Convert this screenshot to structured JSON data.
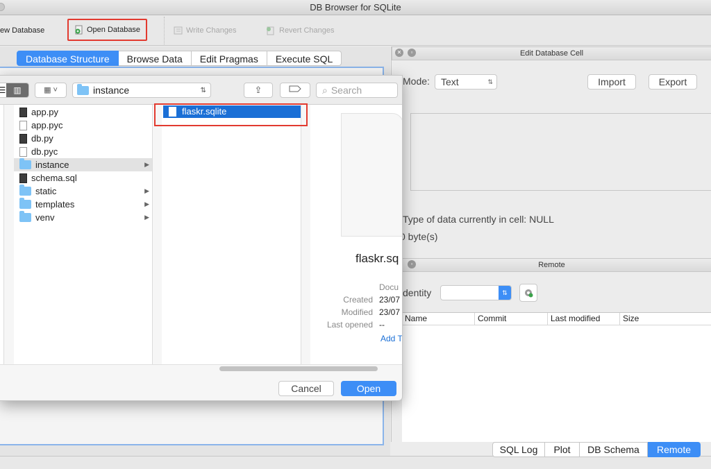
{
  "window": {
    "title": "DB Browser for SQLite"
  },
  "toolbar": {
    "new_database": "ew Database",
    "open_database": "Open Database",
    "write_changes": "Write Changes",
    "revert_changes": "Revert Changes"
  },
  "main_tabs": [
    "Database Structure",
    "Browse Data",
    "Edit Pragmas",
    "Execute SQL"
  ],
  "edit_cell": {
    "title": "Edit Database Cell",
    "mode_label": "Mode:",
    "mode_value": "Text",
    "import_label": "Import",
    "export_label": "Export",
    "type_info": "Type of data currently in cell: NULL",
    "size_info": "0 byte(s)"
  },
  "remote": {
    "title": "Remote",
    "identity_label": "dentity",
    "columns": [
      "Name",
      "Commit",
      "Last modified",
      "Size"
    ]
  },
  "bottom_tabs": [
    "SQL Log",
    "Plot",
    "DB Schema",
    "Remote"
  ],
  "dialog": {
    "location": "instance",
    "search_placeholder": "Search",
    "files": [
      {
        "name": "app.py",
        "icon": "script"
      },
      {
        "name": "app.pyc",
        "icon": "file"
      },
      {
        "name": "db.py",
        "icon": "script"
      },
      {
        "name": "db.pyc",
        "icon": "file"
      },
      {
        "name": "instance",
        "icon": "folder"
      },
      {
        "name": "schema.sql",
        "icon": "script"
      },
      {
        "name": "static",
        "icon": "folder"
      },
      {
        "name": "templates",
        "icon": "folder"
      },
      {
        "name": "venv",
        "icon": "folder"
      }
    ],
    "selected_file": "flaskr.sqlite",
    "preview": {
      "name": "flaskr.sq",
      "kind": "Docu",
      "created_label": "Created",
      "created_value": "23/07",
      "modified_label": "Modified",
      "modified_value": "23/07",
      "last_opened_label": "Last opened",
      "last_opened_value": "--",
      "add_tags": "Add T"
    },
    "cancel_label": "Cancel",
    "open_label": "Open"
  },
  "colors": {
    "accent": "#3d8ef6",
    "highlight": "#e23a2f",
    "folder": "#7ec3f6"
  }
}
